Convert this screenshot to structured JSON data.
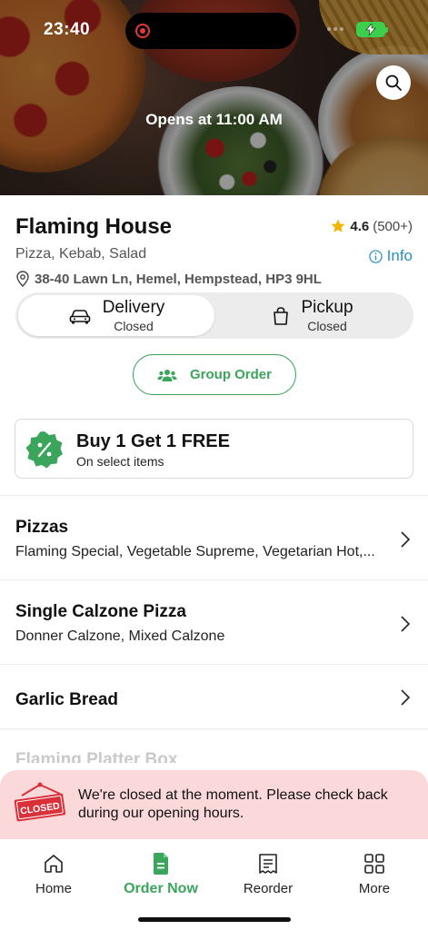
{
  "status_bar": {
    "time": "23:40"
  },
  "hero": {
    "opens_text": "Opens at 11:00 AM"
  },
  "restaurant": {
    "name": "Flaming House",
    "rating": "4.6",
    "rating_count": "(500+)",
    "cuisine": "Pizza, Kebab, Salad",
    "info_label": "Info",
    "address": "38-40 Lawn Ln, Hemel, Hempstead, HP3 9HL"
  },
  "order_mode": {
    "delivery_label": "Delivery",
    "delivery_status": "Closed",
    "pickup_label": "Pickup",
    "pickup_status": "Closed",
    "selected": "Delivery"
  },
  "group_order_label": "Group Order",
  "offer": {
    "title": "Buy 1 Get 1 FREE",
    "subtitle": "On select items"
  },
  "categories": [
    {
      "title": "Pizzas",
      "items": "Flaming Special, Vegetable Supreme, Vegetarian Hot,..."
    },
    {
      "title": "Single Calzone Pizza",
      "items": "Donner Calzone, Mixed Calzone"
    },
    {
      "title": "Garlic Bread",
      "items": ""
    },
    {
      "title": "Flaming Platter Box",
      "items": ""
    }
  ],
  "closed_notice": {
    "sign_text": "CLOSED",
    "message": "We're closed at the moment. Please check back during our opening hours."
  },
  "bottom_nav": [
    {
      "label": "Home",
      "icon": "home-icon"
    },
    {
      "label": "Order Now",
      "icon": "order-icon"
    },
    {
      "label": "Reorder",
      "icon": "receipt-icon"
    },
    {
      "label": "More",
      "icon": "grid-icon"
    }
  ],
  "colors": {
    "brand_green": "#3ba55c",
    "info_blue": "#2b8fc7",
    "closed_banner_bg": "#fbd9da",
    "closed_sign_red": "#d9303a",
    "star": "#f5b400"
  }
}
